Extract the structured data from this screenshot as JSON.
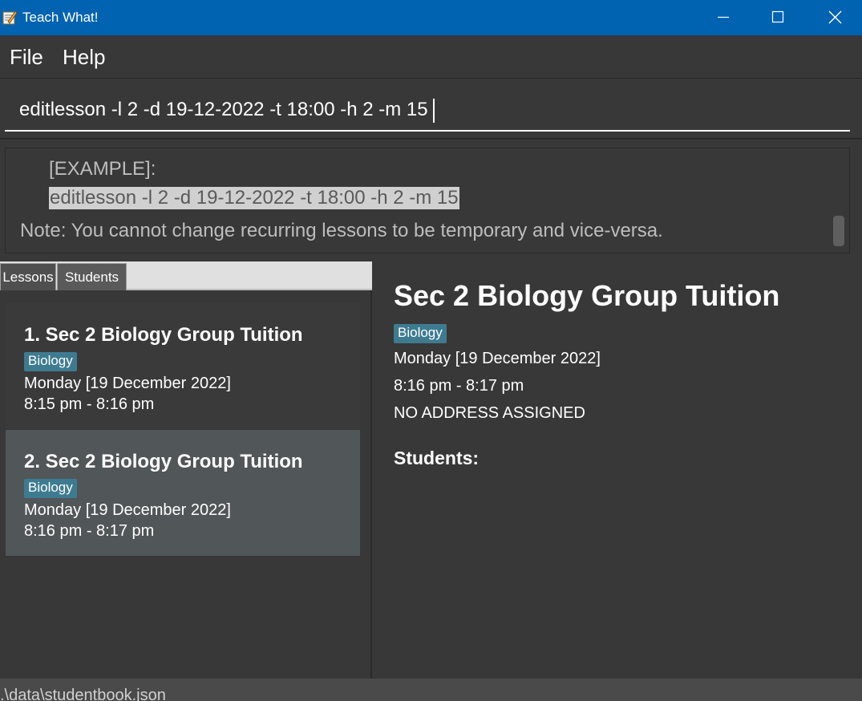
{
  "window": {
    "title": "Teach What!",
    "icon": "notepad-icon",
    "controls": [
      "minimize-icon",
      "maximize-icon",
      "close-icon"
    ],
    "titlebar_color": "#0063b1"
  },
  "menu": {
    "file_label": "File",
    "help_label": "Help"
  },
  "command_box": {
    "value": "editlesson -l 2 -d 19-12-2022 -t 18:00 -h 2 -m 15"
  },
  "result_display": {
    "line1": "[EXAMPLE]:",
    "line2": "editlesson -l 2 -d 19-12-2022 -t 18:00 -h 2 -m 15",
    "line3": "Note: You cannot change recurring lessons to be temporary and vice-versa."
  },
  "tabs": [
    {
      "label": "Lessons"
    },
    {
      "label": "Students"
    }
  ],
  "lessons": [
    {
      "title": "1.  Sec 2 Biology Group Tuition",
      "tag": "Biology",
      "date": "Monday [19 December 2022]",
      "time": "8:15 pm - 8:16 pm"
    },
    {
      "title": "2.  Sec 2 Biology Group Tuition",
      "tag": "Biology",
      "date": "Monday [19 December 2022]",
      "time": "8:16 pm - 8:17 pm"
    }
  ],
  "detail": {
    "title": "Sec 2 Biology Group Tuition",
    "tag": "Biology",
    "date": "Monday [19 December 2022]",
    "time": "8:16 pm - 8:17 pm",
    "address": "NO ADDRESS ASSIGNED",
    "students_heading": "Students:"
  },
  "status_bar": {
    "path": ".\\data\\studentbook.json"
  },
  "colors": {
    "background": "#383838",
    "tag": "#3e7b91",
    "selected_card": "#515658"
  }
}
